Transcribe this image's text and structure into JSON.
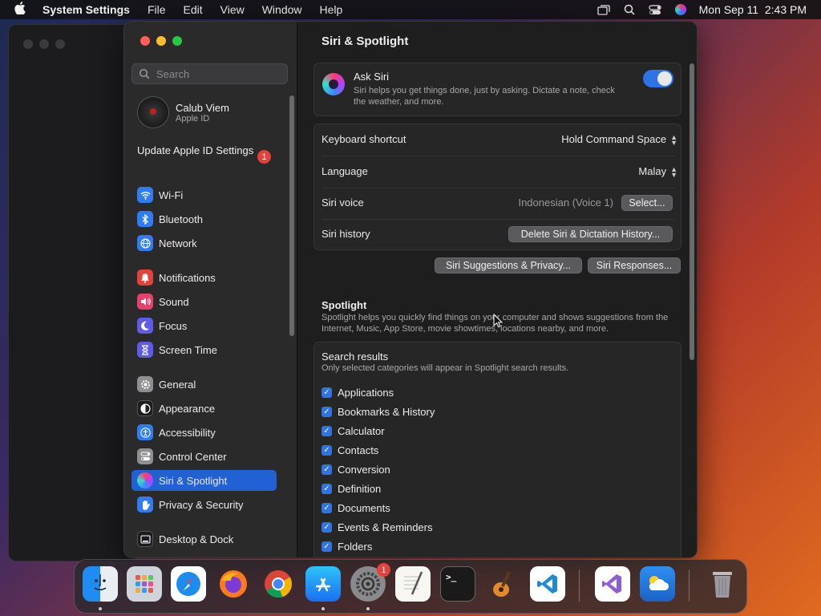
{
  "menubar": {
    "app_name": "System Settings",
    "menus": [
      "File",
      "Edit",
      "View",
      "Window",
      "Help"
    ],
    "datetime": "Mon Sep 11  2:43 PM"
  },
  "sidebar": {
    "search_placeholder": "Search",
    "account": {
      "name": "Calub Viem",
      "subtitle": "Apple ID"
    },
    "update": {
      "label": "Update Apple ID Settings",
      "badge": "1"
    },
    "items": [
      {
        "label": "Wi-Fi",
        "icon": "wifi-icon",
        "color": "#2f7cf6"
      },
      {
        "label": "Bluetooth",
        "icon": "bluetooth-icon",
        "color": "#2f7cf6"
      },
      {
        "label": "Network",
        "icon": "globe-icon",
        "color": "#2f7cf6"
      },
      {
        "label": "Notifications",
        "icon": "bell-icon",
        "color": "#e5413b"
      },
      {
        "label": "Sound",
        "icon": "speaker-icon",
        "color": "#e5416b"
      },
      {
        "label": "Focus",
        "icon": "moon-icon",
        "color": "#5e5ce6"
      },
      {
        "label": "Screen Time",
        "icon": "hourglass-icon",
        "color": "#5e5ce6"
      },
      {
        "label": "General",
        "icon": "gear-icon",
        "color": "#8e8e93"
      },
      {
        "label": "Appearance",
        "icon": "appearance-icon",
        "color": "#1c1c1e"
      },
      {
        "label": "Accessibility",
        "icon": "accessibility-icon",
        "color": "#2f7cf6"
      },
      {
        "label": "Control Center",
        "icon": "control-center-icon",
        "color": "#8e8e93"
      },
      {
        "label": "Siri & Spotlight",
        "icon": "siri-icon",
        "color": "#4a3a8a",
        "selected": true
      },
      {
        "label": "Privacy & Security",
        "icon": "hand-icon",
        "color": "#2f7cf6"
      },
      {
        "label": "Desktop & Dock",
        "icon": "desktop-icon",
        "color": "#1c1c1e"
      }
    ]
  },
  "content": {
    "title": "Siri & Spotlight",
    "ask_siri": {
      "title": "Ask Siri",
      "description": "Siri helps you get things done, just by asking. Dictate a note, check the weather, and more.",
      "enabled": true
    },
    "settings": {
      "keyboard_shortcut": {
        "label": "Keyboard shortcut",
        "value": "Hold Command Space"
      },
      "language": {
        "label": "Language",
        "value": "Malay"
      },
      "siri_voice": {
        "label": "Siri voice",
        "value": "Indonesian (Voice 1)",
        "button": "Select..."
      },
      "siri_history": {
        "label": "Siri history",
        "button": "Delete Siri & Dictation History..."
      }
    },
    "buttons": {
      "suggestions": "Siri Suggestions & Privacy...",
      "responses": "Siri Responses..."
    },
    "spotlight": {
      "title": "Spotlight",
      "description": "Spotlight helps you quickly find things on your computer and shows suggestions from the Internet, Music, App Store, movie showtimes, locations nearby, and more."
    },
    "search_results": {
      "title": "Search results",
      "description": "Only selected categories will appear in Spotlight search results.",
      "categories": [
        {
          "label": "Applications",
          "checked": true
        },
        {
          "label": "Bookmarks & History",
          "checked": true
        },
        {
          "label": "Calculator",
          "checked": true
        },
        {
          "label": "Contacts",
          "checked": true
        },
        {
          "label": "Conversion",
          "checked": true
        },
        {
          "label": "Definition",
          "checked": true
        },
        {
          "label": "Documents",
          "checked": true
        },
        {
          "label": "Events & Reminders",
          "checked": true
        },
        {
          "label": "Folders",
          "checked": true
        }
      ]
    }
  },
  "dock": {
    "items": [
      {
        "name": "finder-icon",
        "running": true
      },
      {
        "name": "launchpad-icon",
        "running": false
      },
      {
        "name": "safari-icon",
        "running": false
      },
      {
        "name": "firefox-icon",
        "running": false
      },
      {
        "name": "chrome-icon",
        "running": false
      },
      {
        "name": "app-store-icon",
        "running": true
      },
      {
        "name": "system-settings-icon",
        "running": true,
        "badge": "1"
      },
      {
        "name": "textedit-icon",
        "running": false
      },
      {
        "name": "terminal-icon",
        "running": false
      },
      {
        "name": "garageband-icon",
        "running": false
      },
      {
        "name": "vscode-icon",
        "running": false
      },
      {
        "name": "visual-studio-icon",
        "running": false
      },
      {
        "name": "weather-icon",
        "running": false
      },
      {
        "name": "trash-icon",
        "running": false
      }
    ]
  }
}
